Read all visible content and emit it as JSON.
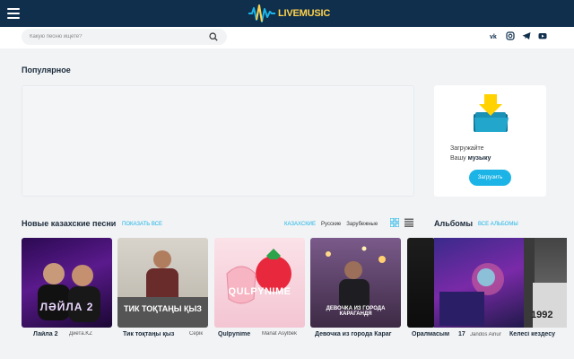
{
  "header": {
    "logo_live": "LIVE",
    "logo_music": "MUSIC",
    "menu_icon": "hamburger-icon"
  },
  "search": {
    "placeholder": "Какую песню ищете?",
    "icon": "search-icon"
  },
  "socials": [
    "vk-icon",
    "instagram-icon",
    "telegram-icon",
    "youtube-icon"
  ],
  "popular": {
    "title": "Популярное"
  },
  "upload": {
    "line1": "Загружайте",
    "line2_prefix": "Вашу",
    "line2_bold": "музыку",
    "button": "Загрузить"
  },
  "new_songs": {
    "title": "Новые казахские песни",
    "show_all": "ПОКАЗАТЬ ВСЕ",
    "filters": [
      "КАЗАХСКИЕ",
      "Русские",
      "Зарубежные"
    ],
    "active_filter": "КАЗАХСКИЕ",
    "items": [
      {
        "title": "Лайла 2",
        "artist": "Диета.KZ",
        "cover_text": "ЛӘЙЛА 2"
      },
      {
        "title": "Тик тоқтаңы қыз",
        "artist": "Серік",
        "cover_text": "ТИК ТОҚТАҢЫ ҚЫЗ"
      },
      {
        "title": "Qulpynime",
        "artist": "Manat Asylbek",
        "cover_text": "QULPYNIME"
      },
      {
        "title": "Девочка из города Караг",
        "artist": "",
        "cover_text": "ДЕВОЧКА ИЗ ГОРОДА КАРАГАНДЯ"
      },
      {
        "title": "Оралмасым",
        "artist": "",
        "cover_text": ""
      }
    ]
  },
  "albums": {
    "title": "Альбомы",
    "all": "ВСЕ АЛЬБОМЫ",
    "items": [
      {
        "title": "17",
        "artist": "Jandos Ainur",
        "cover_text": "17"
      },
      {
        "title": "Келесі кездесу",
        "artist": "",
        "cover_text": "1992"
      }
    ]
  },
  "colors": {
    "header": "#0f2f4d",
    "accent": "#1cb4e6",
    "logo": "#ffd24a",
    "page": "#f1f3f5"
  }
}
